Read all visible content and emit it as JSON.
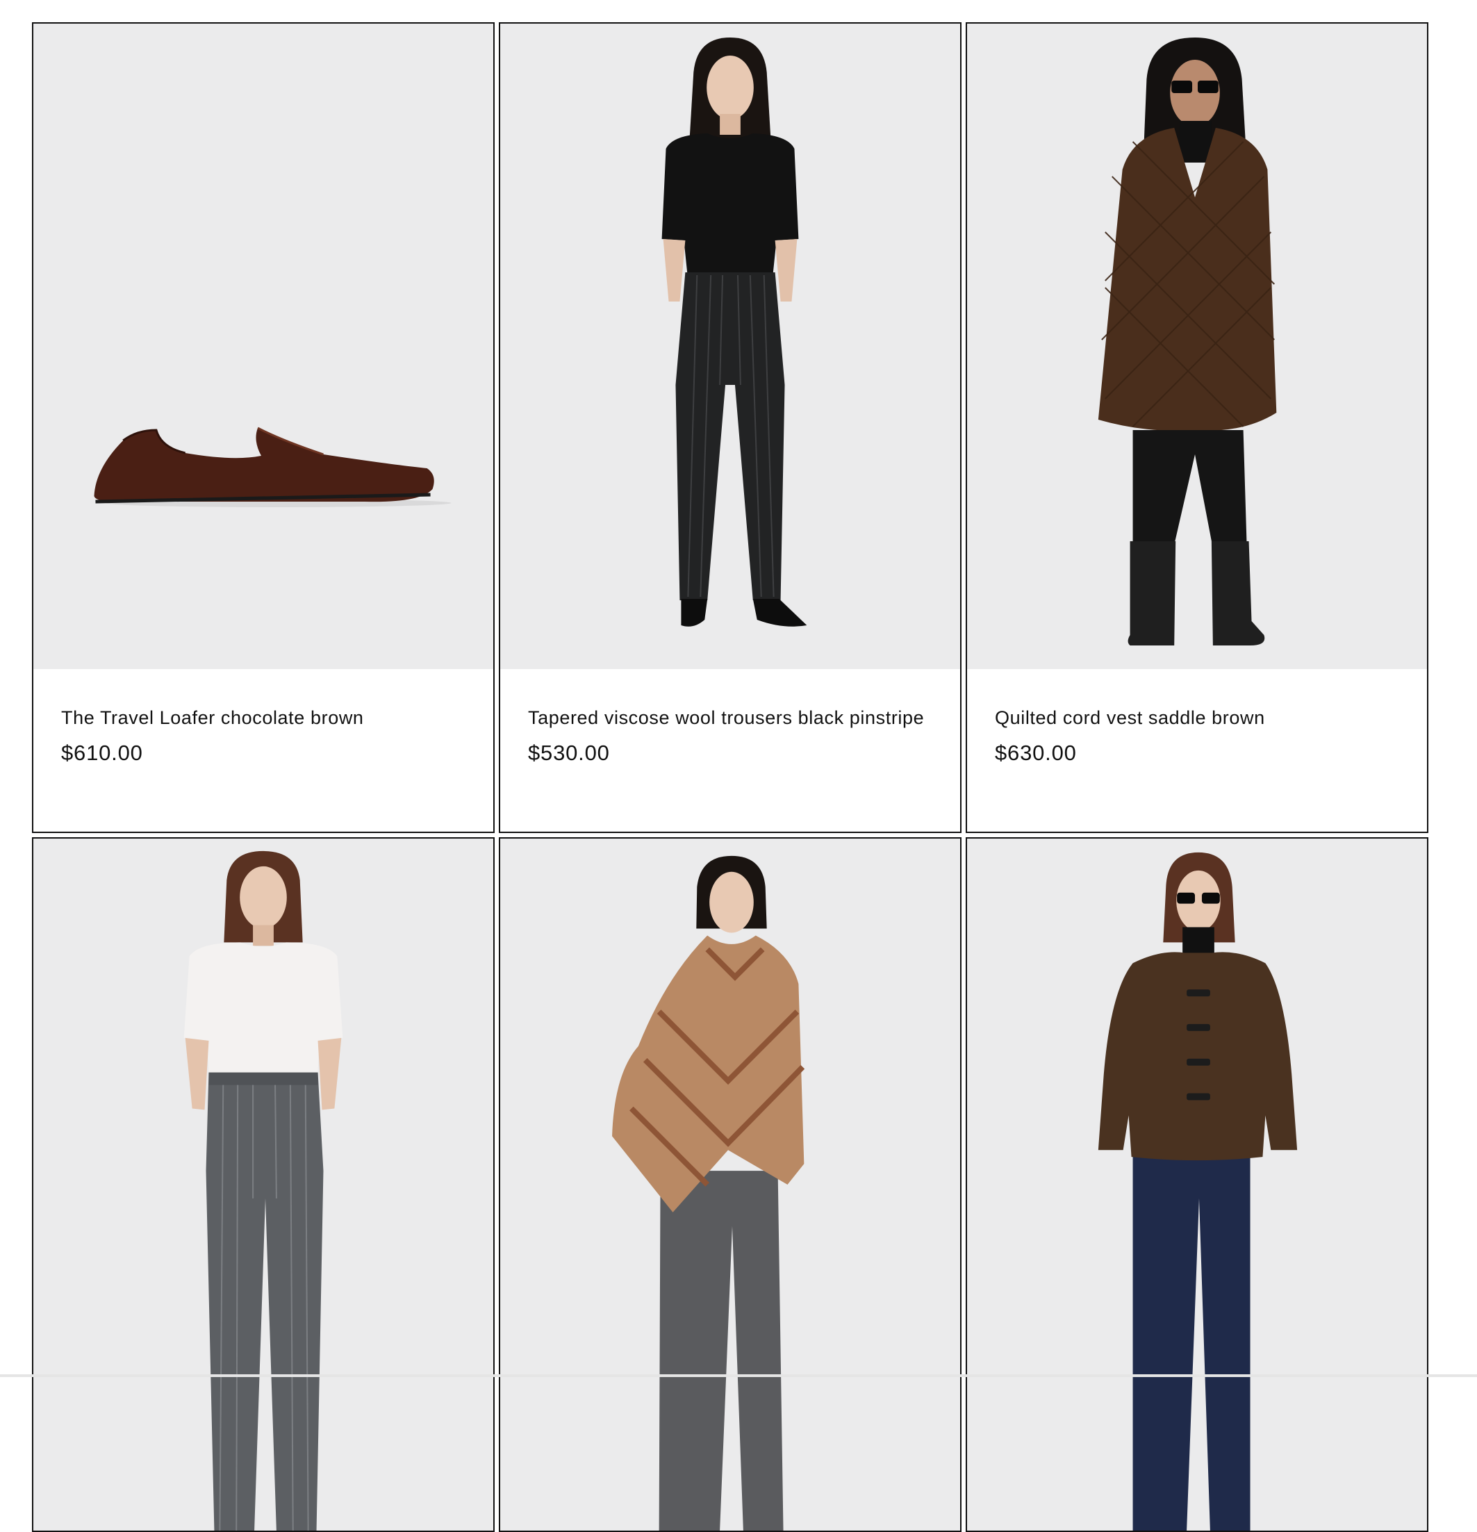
{
  "products": [
    {
      "name": "The Travel Loafer chocolate brown",
      "price": "$610.00"
    },
    {
      "name": "Tapered viscose wool trousers black pinstripe",
      "price": "$530.00"
    },
    {
      "name": "Quilted cord vest saddle brown",
      "price": "$630.00"
    },
    {
      "name": "",
      "price": ""
    },
    {
      "name": "",
      "price": ""
    },
    {
      "name": "",
      "price": ""
    }
  ],
  "colors": {
    "image_background": "#ebebec",
    "card_border": "#111111",
    "text": "#111111"
  }
}
